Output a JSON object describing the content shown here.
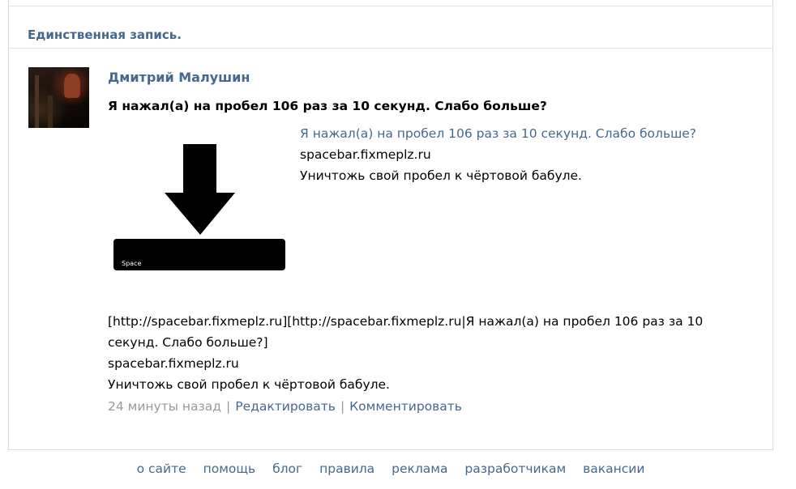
{
  "section": {
    "title": "Единственная запись."
  },
  "post": {
    "author": "Дмитрий Малушин",
    "title": "Я нажал(а) на пробел 106 раз за 10 секунд. Слабо больше?",
    "image_label": "Space",
    "link_preview": {
      "title": "Я нажал(а) на пробел 106 раз за 10 секунд. Слабо больше?",
      "domain": "spacebar.fixmeplz.ru",
      "description": "Уничтожь свой пробел к чёртовой бабуле."
    },
    "body_lines": [
      "[http://spacebar.fixmeplz.ru][http://spacebar.fixmeplz.ru|Я нажал(а) на пробел 106 раз за 10",
      "секунд. Слабо больше?]",
      "spacebar.fixmeplz.ru",
      "Уничтожь свой пробел к чёртовой бабуле."
    ],
    "time": "24 минуты назад",
    "separator": "|",
    "edit_label": "Редактировать",
    "comment_label": "Комментировать"
  },
  "footer": {
    "links": [
      "о сайте",
      "помощь",
      "блог",
      "правила",
      "реклама",
      "разработчикам",
      "вакансии"
    ]
  },
  "colors": {
    "link": "#45688e",
    "muted": "#999999",
    "border": "#dadada"
  }
}
